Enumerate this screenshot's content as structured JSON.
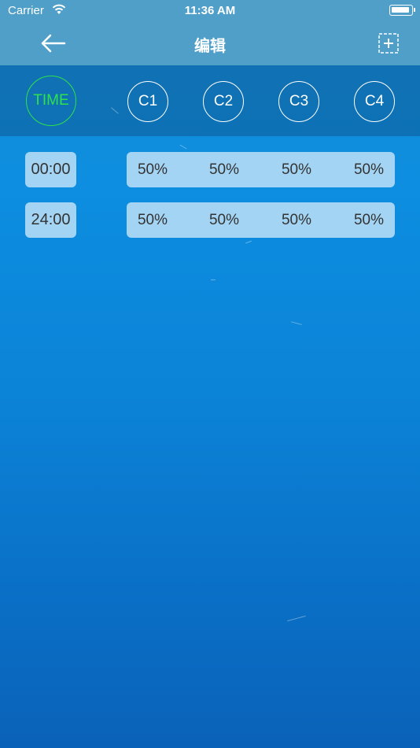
{
  "status_bar": {
    "carrier": "Carrier",
    "time": "11:36 AM"
  },
  "nav": {
    "title": "编辑",
    "back_icon": "arrow-left-icon",
    "add_icon": "add-box-icon"
  },
  "channels": {
    "time_label": "TIME",
    "time_color": "#2ee24a",
    "c1": "C1",
    "c2": "C2",
    "c3": "C3",
    "c4": "C4"
  },
  "rows": [
    {
      "time": "00:00",
      "c1": "50%",
      "c2": "50%",
      "c3": "50%",
      "c4": "50%"
    },
    {
      "time": "24:00",
      "c1": "50%",
      "c2": "50%",
      "c3": "50%",
      "c4": "50%"
    }
  ]
}
